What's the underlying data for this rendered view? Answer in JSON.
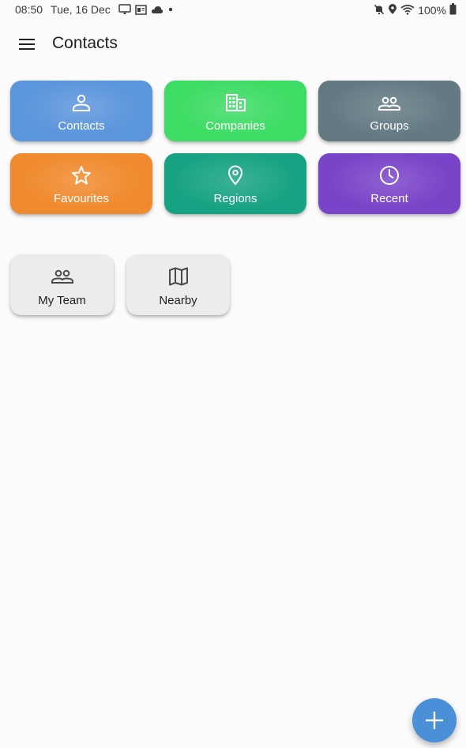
{
  "status_bar": {
    "time": "08:50",
    "date": "Tue, 16 Dec",
    "battery": "100%",
    "left_icons": [
      "cast-icon",
      "news-icon",
      "cloud-icon",
      "dot-icon"
    ],
    "right_icons": [
      "mute-icon",
      "location-icon",
      "wifi-icon",
      "battery-icon"
    ]
  },
  "app_bar": {
    "title": "Contacts",
    "menu_icon": "menu-icon"
  },
  "tiles": [
    {
      "label": "Contacts",
      "icon": "person-icon",
      "color": "#5b95db"
    },
    {
      "label": "Companies",
      "icon": "building-icon",
      "color": "#3ddc64"
    },
    {
      "label": "Groups",
      "icon": "group-icon",
      "color": "#647a83"
    },
    {
      "label": "Favourites",
      "icon": "star-icon",
      "color": "#f08a2e"
    },
    {
      "label": "Regions",
      "icon": "location-pin-icon",
      "color": "#17a383"
    },
    {
      "label": "Recent",
      "icon": "clock-icon",
      "color": "#7a44c8"
    }
  ],
  "quick_access": [
    {
      "label": "My Team",
      "icon": "group-icon"
    },
    {
      "label": "Nearby",
      "icon": "map-icon"
    }
  ],
  "fab": {
    "icon": "plus-icon",
    "color": "#4a90d9"
  }
}
